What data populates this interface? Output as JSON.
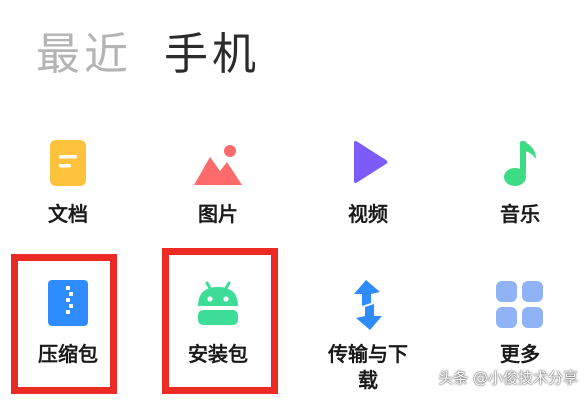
{
  "tabs": {
    "recent": "最近",
    "phone": "手机"
  },
  "categories": [
    {
      "id": "documents",
      "label": "文档",
      "icon": "document-icon",
      "color": "#FFC23D"
    },
    {
      "id": "images",
      "label": "图片",
      "icon": "image-icon",
      "color": "#FF6B6B"
    },
    {
      "id": "videos",
      "label": "视频",
      "icon": "play-icon",
      "color": "#7B5CFA"
    },
    {
      "id": "music",
      "label": "音乐",
      "icon": "music-note-icon",
      "color": "#3DDC84"
    },
    {
      "id": "archives",
      "label": "压缩包",
      "icon": "zip-icon",
      "color": "#2F8CFF",
      "highlighted": true
    },
    {
      "id": "apks",
      "label": "安装包",
      "icon": "android-icon",
      "color": "#3DDC97",
      "highlighted": true
    },
    {
      "id": "transfers",
      "label": "传输与下载",
      "line1": "传输与下",
      "line2": "载",
      "icon": "transfer-icon",
      "color": "#2F8CFF"
    },
    {
      "id": "more",
      "label": "更多",
      "icon": "grid-icon",
      "color": "#8FB3F6"
    }
  ],
  "highlight_color": "#EE2A24",
  "watermark": "头条 @小俊技术分享"
}
